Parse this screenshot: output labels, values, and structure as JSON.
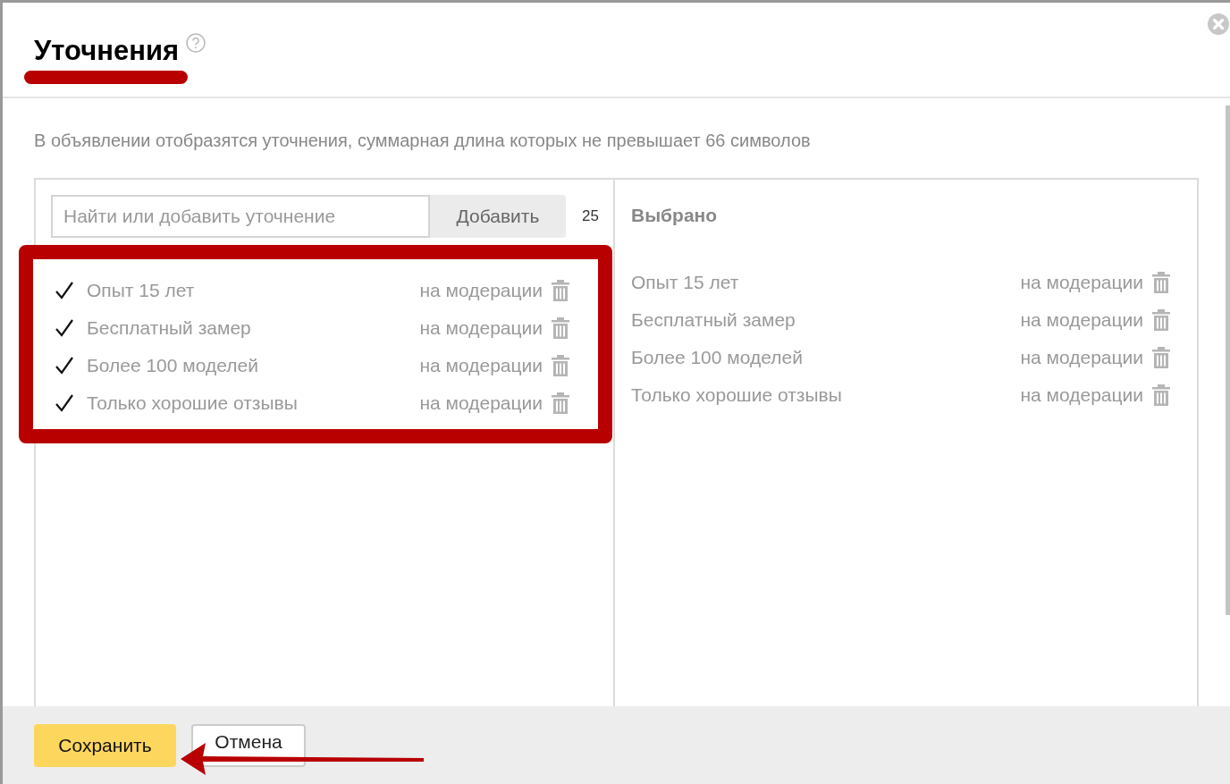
{
  "dialog": {
    "title": "Уточнения",
    "description": "В объявлении отобразятся уточнения, суммарная длина которых не превышает 66 символов",
    "search": {
      "placeholder": "Найти или добавить уточнение"
    },
    "add_button": "Добавить",
    "counter": "25",
    "suggestions": [
      {
        "text": "Опыт 15 лет",
        "status": "на модерации",
        "checked": true
      },
      {
        "text": "Бесплатный замер",
        "status": "на модерации",
        "checked": true
      },
      {
        "text": "Более 100 моделей",
        "status": "на модерации",
        "checked": true
      },
      {
        "text": "Только хорошие отзывы",
        "status": "на модерации",
        "checked": true
      }
    ],
    "selected_title": "Выбрано",
    "selected": [
      {
        "text": "Опыт 15 лет",
        "status": "на модерации"
      },
      {
        "text": "Бесплатный замер",
        "status": "на модерации"
      },
      {
        "text": "Более 100 моделей",
        "status": "на модерации"
      },
      {
        "text": "Только хорошие отзывы",
        "status": "на модерации"
      }
    ],
    "buttons": [
      {
        "label": "Сохранить",
        "kind": "primary"
      },
      {
        "label": "Отмена",
        "kind": "secondary"
      }
    ]
  }
}
